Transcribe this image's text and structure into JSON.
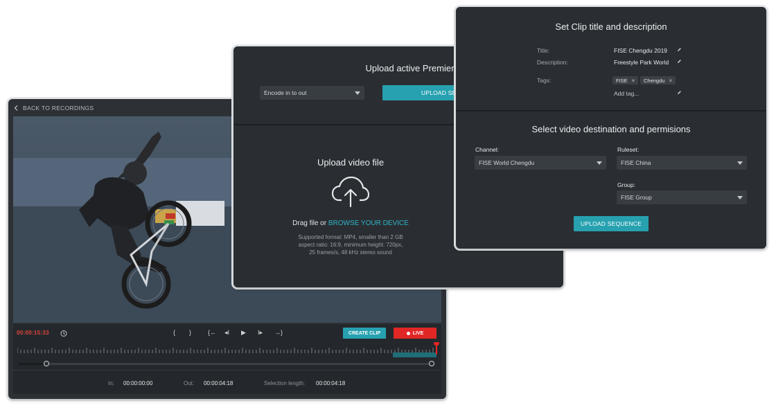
{
  "player": {
    "back_label": "BACK TO RECORDINGS",
    "timecode": "00:00:15:33",
    "controls": {
      "mark_in": "{",
      "mark_out": "}",
      "go_in": "{←",
      "step_back": "◂I",
      "play": "▶",
      "step_fwd": "I▸",
      "go_out": "→}"
    },
    "create_clip_label": "CREATE CLIP",
    "live_label": "LIVE",
    "in_label": "In:",
    "in_value": "00:00:00:00",
    "out_label": "Out:",
    "out_value": "00:00:04:18",
    "selection_label": "Selection length:",
    "selection_value": "00:00:04:18",
    "accent_color": "#e12626"
  },
  "upload": {
    "premiere_title": "Upload active Premiere Pro sequence",
    "encode_select": "Encode in to out",
    "upload_button": "UPLOAD SEQUENCE",
    "video_title": "Upload video file",
    "drag_text": "Drag file or",
    "browse_link": "BROWSE YOUR DEVICE",
    "requirements": [
      "Supported format: MP4, smaller than 2 GB",
      "aspect ratio: 16:9, minimum height: 720px,",
      "25 frames/s, 48 kHz stereo sound"
    ],
    "accent_color": "#27a1b0"
  },
  "clip": {
    "title": "Set Clip title and description",
    "title_label": "Title:",
    "title_value": "FISE Chengdu 2019",
    "description_label": "Description:",
    "description_value": "Freestyle Park World",
    "tags_label": "Tags:",
    "tags": [
      "FISE",
      "Chengdu"
    ],
    "add_tag_placeholder": "Add tag...",
    "dest_title": "Select video destination and permisions",
    "channel_label": "Channel:",
    "channel_value": "FISE World Chengdu",
    "ruleset_label": "Ruleset:",
    "ruleset_value": "FISE China",
    "group_label": "Group:",
    "group_value": "FISE Group",
    "upload_button": "UPLOAD SEQUENCE"
  }
}
